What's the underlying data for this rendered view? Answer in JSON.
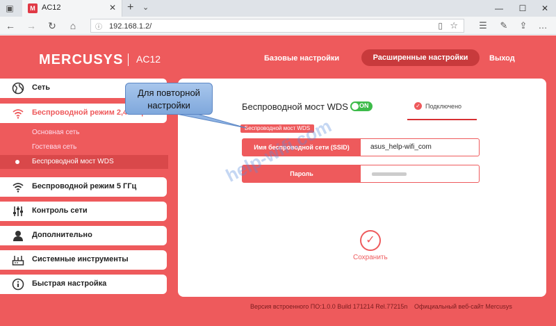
{
  "browser": {
    "tab_title": "AC12",
    "tab_favicon": "M",
    "url": "192.168.1.2/",
    "icons": [
      "back-icon",
      "forward-icon",
      "refresh-icon",
      "home-icon",
      "reading-view-icon",
      "favorite-star-icon",
      "favorites-hub-icon",
      "pen-icon",
      "share-icon",
      "more-icon",
      "minimize-icon",
      "maximize-icon",
      "close-icon"
    ]
  },
  "header": {
    "logo": "MERCUSYS",
    "model": "AC12",
    "links": {
      "basic": "Базовые настройки",
      "advanced": "Расширенные настройки",
      "exit": "Выход"
    }
  },
  "sidebar": {
    "items": [
      {
        "label": "Сеть",
        "icon": "globe-icon"
      },
      {
        "label": "Беспроводной режим 2,4 ГГц",
        "icon": "wifi-icon",
        "active": true
      },
      {
        "label": "Беспроводной режим 5 ГГц",
        "icon": "wifi-icon"
      },
      {
        "label": "Контроль сети",
        "icon": "sliders-icon"
      },
      {
        "label": "Дополнительно",
        "icon": "user-icon"
      },
      {
        "label": "Системные инструменты",
        "icon": "router-icon"
      },
      {
        "label": "Быстрая настройка",
        "icon": "info-icon"
      }
    ],
    "subitems": [
      {
        "label": "Основная сеть"
      },
      {
        "label": "Гостевая сеть"
      },
      {
        "label": "Беспроводной мост WDS",
        "active": true
      }
    ]
  },
  "panel": {
    "title": "Беспроводной мост WDS",
    "toggle": "ON",
    "status": "Подключено",
    "tag": "Беспроводной мост WDS",
    "ssid_label": "Имя беспроводной сети (SSID)",
    "ssid_value": "asus_help-wifi_com",
    "password_label": "Пароль",
    "save_label": "Сохранить"
  },
  "callout": {
    "line1": "Для повторной",
    "line2": "настройки"
  },
  "watermark": "help-wifi.com",
  "footer": {
    "firmware": "Версия встроенного ПО:1.0.0 Build 171214 Rel.77215n",
    "site": "Официальный веб-сайт Mercusys"
  },
  "colors": {
    "brand": "#ee5a5c",
    "toggle_on": "#3dbb4a",
    "callout": "#8fb4e4"
  }
}
